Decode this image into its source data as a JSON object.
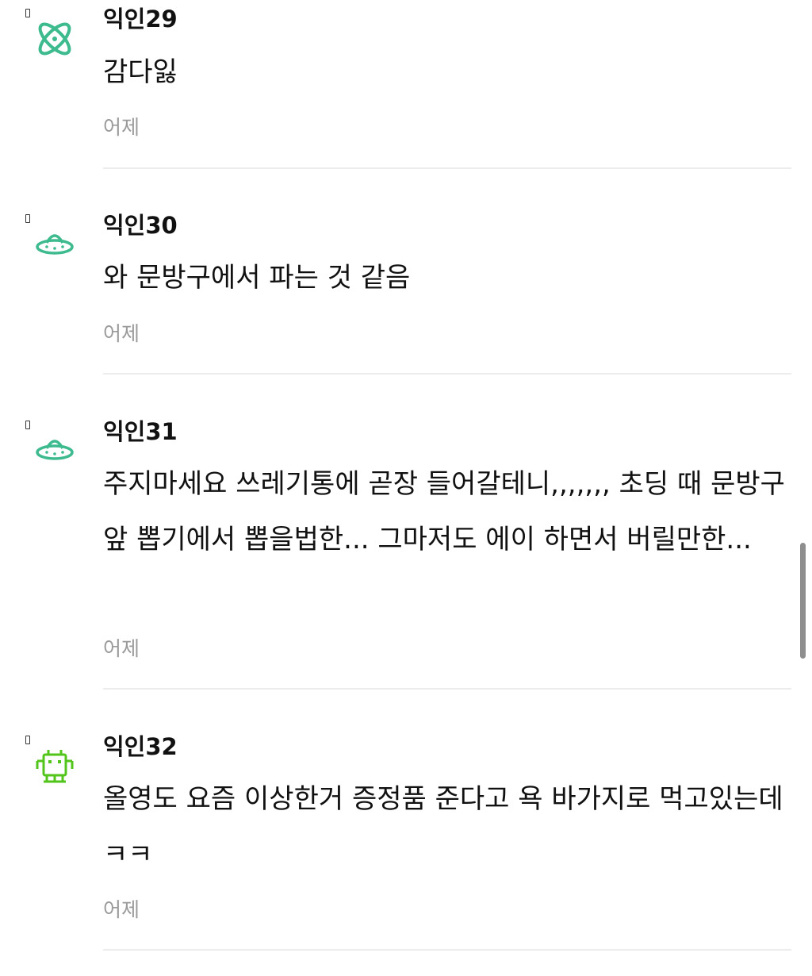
{
  "comments": [
    {
      "author": "익인29",
      "body": "감다잃",
      "time": "어제",
      "avatar_icon": "atom-icon",
      "avatar_color": "#3dbb8e"
    },
    {
      "author": "익인30",
      "body": "와 문방구에서 파는 것 같음",
      "time": "어제",
      "avatar_icon": "ufo-icon",
      "avatar_color": "#3dbb8e"
    },
    {
      "author": "익인31",
      "body": "주지마세요 쓰레기통에 곧장 들어갈테니,,,,,,, 초딩 때 문방구 앞 뽑기에서 뽑을법한... 그마저도 에이 하면서 버릴만한...",
      "time": "어제",
      "avatar_icon": "ufo-icon",
      "avatar_color": "#3dbb8e"
    },
    {
      "author": "익인32",
      "body": "올영도 요즘 이상한거 증정품 준다고 욕 바가지로 먹고있는데 ㅋㅋ",
      "time": "어제",
      "avatar_icon": "space-invader-icon",
      "avatar_color": "#52c41a"
    }
  ]
}
